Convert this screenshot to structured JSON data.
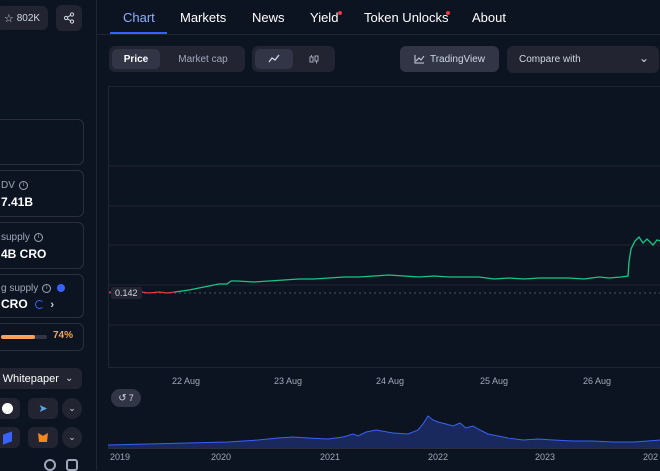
{
  "sidebar": {
    "watchlist_count": "802K",
    "fdv": {
      "label": "DV",
      "value": "7.41B"
    },
    "total_supply": {
      "label": "supply",
      "value": "4B CRO"
    },
    "max_supply": {
      "label": "g supply",
      "value": "CRO"
    },
    "progress": {
      "percent_text": "74%",
      "fraction": 0.74
    },
    "whitepaper_label": "Whitepaper"
  },
  "tabs": [
    {
      "label": "Chart"
    },
    {
      "label": "Markets"
    },
    {
      "label": "News"
    },
    {
      "label": "Yield"
    },
    {
      "label": "Token Unlocks"
    },
    {
      "label": "About"
    }
  ],
  "toolbar": {
    "price_label": "Price",
    "marketcap_label": "Market cap",
    "tradingview_label": "TradingView",
    "compare_label": "Compare with"
  },
  "chart": {
    "price_marker": "0.142",
    "x_dates": [
      "22 Aug",
      "23 Aug",
      "24 Aug",
      "25 Aug",
      "26 Aug"
    ],
    "history_badge": "7",
    "x_years": [
      "2019",
      "2020",
      "2021",
      "2022",
      "2023",
      "202"
    ]
  },
  "colors": {
    "accent": "#8fb0ff",
    "line_up": "#16c784",
    "line_down": "#ea3943",
    "navigator": "#3861fb"
  }
}
